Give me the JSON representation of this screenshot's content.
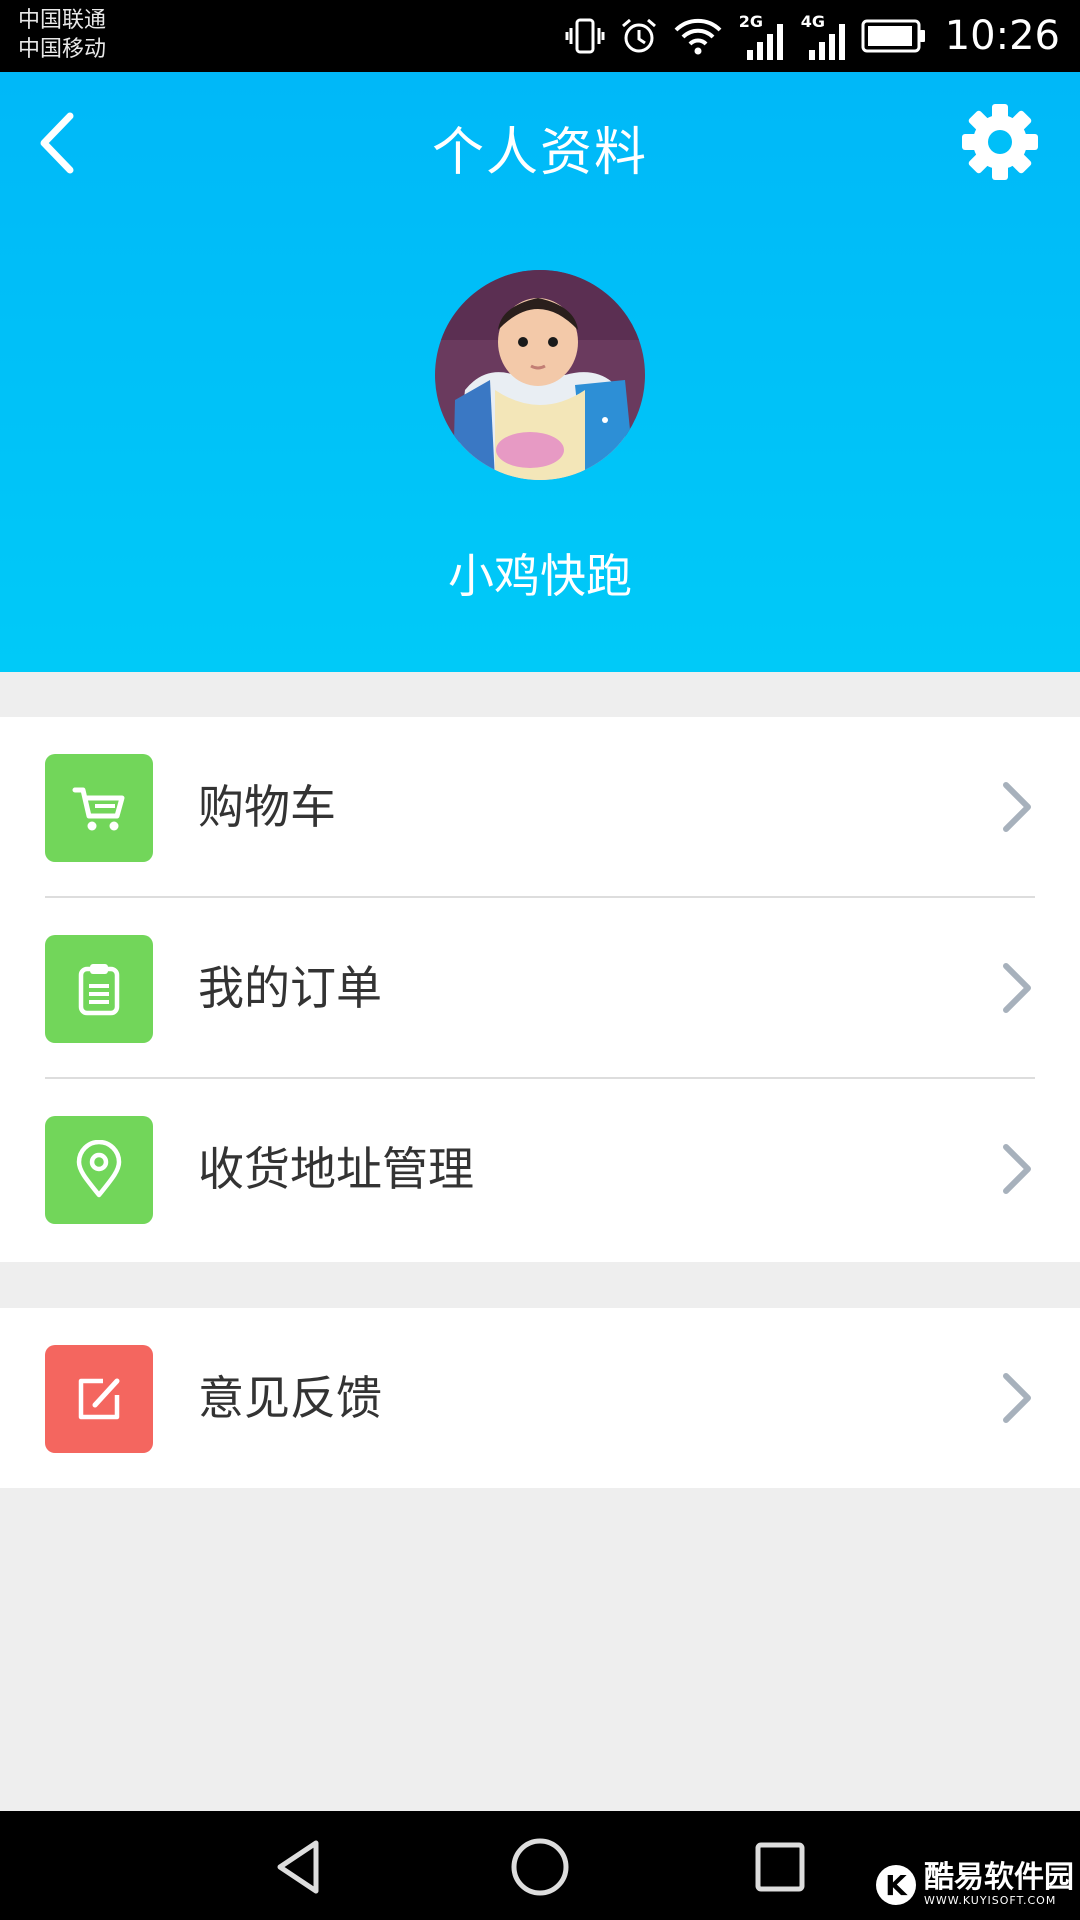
{
  "status_bar": {
    "carrier_1": "中国联通",
    "carrier_2": "中国移动",
    "net_1": "2G",
    "net_2": "4G",
    "time": "10:26",
    "icons": [
      "vibrate-icon",
      "alarm-icon",
      "wifi-icon",
      "signal-2g-icon",
      "signal-4g-icon",
      "battery-icon"
    ]
  },
  "header": {
    "title": "个人资料",
    "back_icon": "chevron-left-icon",
    "settings_icon": "gear-icon",
    "username": "小鸡快跑",
    "gradient_top": "#00b8f8",
    "gradient_bottom": "#00caf8"
  },
  "menu_groups": [
    [
      {
        "label": "购物车",
        "icon": "cart-icon",
        "color": "#72d65a"
      },
      {
        "label": "我的订单",
        "icon": "clipboard-icon",
        "color": "#72d65a"
      },
      {
        "label": "收货地址管理",
        "icon": "location-pin-icon",
        "color": "#72d65a"
      }
    ],
    [
      {
        "label": "意见反馈",
        "icon": "edit-icon",
        "color": "#f4665f"
      }
    ]
  ],
  "nav_bar": {
    "buttons": [
      "back-triangle-icon",
      "home-circle-icon",
      "recents-square-icon"
    ]
  },
  "watermark": {
    "logo_letter": "K",
    "name": "酷易软件园",
    "url": "WWW.KUYISOFT.COM"
  }
}
